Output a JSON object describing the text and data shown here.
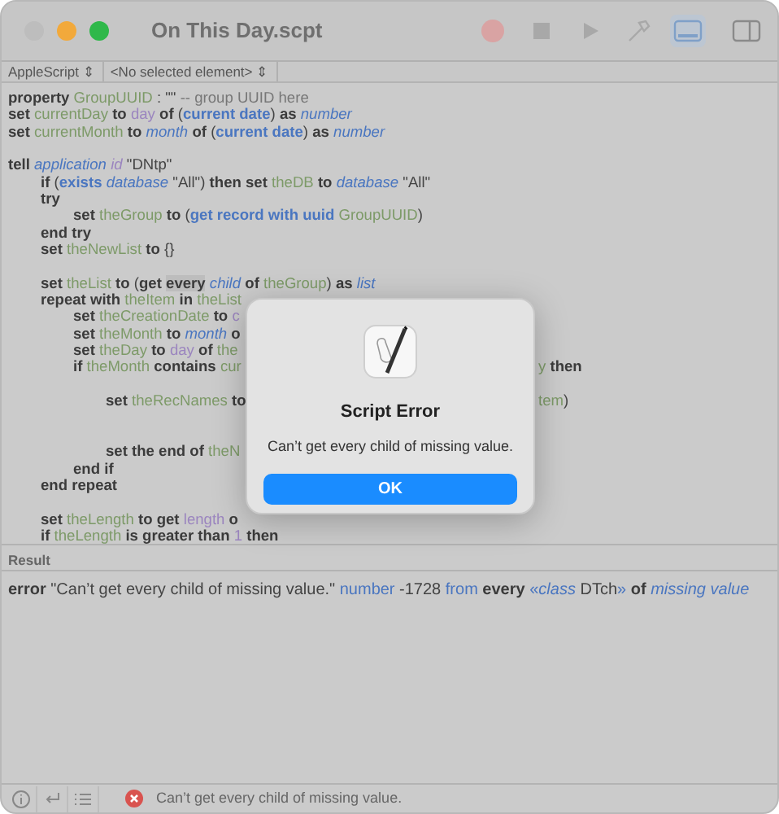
{
  "window": {
    "title": "On This Day.scpt"
  },
  "traffic_lights": [
    {
      "color": "#bdbdbd"
    },
    {
      "color": "#f2a93b"
    },
    {
      "color": "#2fb84a"
    }
  ],
  "toolbar": [
    {
      "kind": "record",
      "selected": false
    },
    {
      "kind": "stop",
      "selected": false
    },
    {
      "kind": "run",
      "selected": false
    },
    {
      "kind": "compile",
      "selected": false
    },
    {
      "kind": "log",
      "selected": true
    },
    {
      "kind": "inspector",
      "selected": false
    }
  ],
  "navigation_bar": [
    {
      "label": "AppleScript",
      "caret": "⇕"
    },
    {
      "label": "<No selected element>",
      "caret": "⇕"
    }
  ],
  "code": [
    {
      "kind": "code",
      "tokens": [
        {
          "kind": "keyword",
          "text": "property "
        },
        {
          "kind": "variable",
          "text": "GroupUUID"
        },
        {
          "kind": "plain",
          "text": " : \"\" "
        },
        {
          "kind": "comment",
          "text": "-- group UUID here"
        }
      ]
    },
    {
      "kind": "code",
      "tokens": [
        {
          "kind": "keyword",
          "text": "set "
        },
        {
          "kind": "variable",
          "text": "currentDay"
        },
        {
          "kind": "keyword",
          "text": " to "
        },
        {
          "kind": "property",
          "text": "day"
        },
        {
          "kind": "keyword",
          "text": " of "
        },
        {
          "kind": "plain",
          "text": "("
        },
        {
          "kind": "command",
          "text": "current date"
        },
        {
          "kind": "plain",
          "text": ") "
        },
        {
          "kind": "keyword",
          "text": "as "
        },
        {
          "kind": "term",
          "text": "number"
        }
      ]
    },
    {
      "kind": "code",
      "tokens": [
        {
          "kind": "keyword",
          "text": "set "
        },
        {
          "kind": "variable",
          "text": "currentMonth"
        },
        {
          "kind": "keyword",
          "text": " to "
        },
        {
          "kind": "term",
          "text": "month"
        },
        {
          "kind": "keyword",
          "text": " of "
        },
        {
          "kind": "plain",
          "text": "("
        },
        {
          "kind": "command",
          "text": "current date"
        },
        {
          "kind": "plain",
          "text": ") "
        },
        {
          "kind": "keyword",
          "text": "as "
        },
        {
          "kind": "term",
          "text": "number"
        }
      ]
    },
    {
      "kind": "blank"
    },
    {
      "kind": "code",
      "tokens": [
        {
          "kind": "keyword",
          "text": "tell "
        },
        {
          "kind": "term",
          "text": "application "
        },
        {
          "kind": "propertyitalic",
          "text": "id"
        },
        {
          "kind": "plain",
          "text": " \"DNtp\""
        }
      ],
      "children": [
        {
          "kind": "code",
          "tokens": [
            {
              "kind": "keyword",
              "text": "if "
            },
            {
              "kind": "plain",
              "text": "("
            },
            {
              "kind": "command",
              "text": "exists "
            },
            {
              "kind": "term",
              "text": "database"
            },
            {
              "kind": "plain",
              "text": " \"All\") "
            },
            {
              "kind": "keyword",
              "text": "then set "
            },
            {
              "kind": "variable",
              "text": "theDB"
            },
            {
              "kind": "keyword",
              "text": " to "
            },
            {
              "kind": "term",
              "text": "database"
            },
            {
              "kind": "plain",
              "text": " \"All\""
            }
          ]
        },
        {
          "kind": "code",
          "tokens": [
            {
              "kind": "keyword",
              "text": "try"
            }
          ],
          "children": [
            {
              "kind": "code",
              "tokens": [
                {
                  "kind": "keyword",
                  "text": "set "
                },
                {
                  "kind": "variable",
                  "text": "theGroup"
                },
                {
                  "kind": "keyword",
                  "text": " to "
                },
                {
                  "kind": "plain",
                  "text": "("
                },
                {
                  "kind": "command",
                  "text": "get record with uuid "
                },
                {
                  "kind": "variable",
                  "text": "GroupUUID"
                },
                {
                  "kind": "plain",
                  "text": ")"
                }
              ]
            }
          ]
        },
        {
          "kind": "code",
          "tokens": [
            {
              "kind": "keyword",
              "text": "end try"
            }
          ]
        },
        {
          "kind": "code",
          "tokens": [
            {
              "kind": "keyword",
              "text": "set "
            },
            {
              "kind": "variable",
              "text": "theNewList"
            },
            {
              "kind": "keyword",
              "text": " to "
            },
            {
              "kind": "plain",
              "text": "{}"
            }
          ]
        },
        {
          "kind": "blank"
        },
        {
          "kind": "code",
          "tokens": [
            {
              "kind": "keyword",
              "text": "set "
            },
            {
              "kind": "variable",
              "text": "theList"
            },
            {
              "kind": "keyword",
              "text": " to "
            },
            {
              "kind": "plain",
              "text": "("
            },
            {
              "kind": "keyword",
              "text": "get "
            },
            {
              "kind": "keyword",
              "text": "every",
              "highlighted": true
            },
            {
              "kind": "term",
              "text": " child"
            },
            {
              "kind": "keyword",
              "text": " of "
            },
            {
              "kind": "variable",
              "text": "theGroup"
            },
            {
              "kind": "plain",
              "text": ") "
            },
            {
              "kind": "keyword",
              "text": "as "
            },
            {
              "kind": "term",
              "text": "list"
            }
          ]
        },
        {
          "kind": "code",
          "tokens": [
            {
              "kind": "keyword",
              "text": "repeat with "
            },
            {
              "kind": "variable",
              "text": "theItem"
            },
            {
              "kind": "keyword",
              "text": " in "
            },
            {
              "kind": "variable",
              "text": "theList"
            }
          ],
          "children": [
            {
              "kind": "code",
              "tokens": [
                {
                  "kind": "keyword",
                  "text": "set "
                },
                {
                  "kind": "variable",
                  "text": "theCreationDate"
                },
                {
                  "kind": "keyword",
                  "text": " to "
                },
                {
                  "kind": "property",
                  "text": "c"
                }
              ]
            },
            {
              "kind": "code",
              "tokens": [
                {
                  "kind": "keyword",
                  "text": "set "
                },
                {
                  "kind": "variable",
                  "text": "theMonth"
                },
                {
                  "kind": "keyword",
                  "text": " to "
                },
                {
                  "kind": "term",
                  "text": "month"
                },
                {
                  "kind": "keyword",
                  "text": " o"
                }
              ]
            },
            {
              "kind": "code",
              "tokens": [
                {
                  "kind": "keyword",
                  "text": "set "
                },
                {
                  "kind": "variable",
                  "text": "theDay"
                },
                {
                  "kind": "keyword",
                  "text": " to "
                },
                {
                  "kind": "property",
                  "text": "day"
                },
                {
                  "kind": "keyword",
                  "text": " of "
                },
                {
                  "kind": "variable",
                  "text": "the"
                }
              ]
            },
            {
              "kind": "code",
              "tokens": [
                {
                  "kind": "keyword",
                  "text": "if "
                },
                {
                  "kind": "variable",
                  "text": "theMonth"
                },
                {
                  "kind": "keyword",
                  "text": " contains "
                },
                {
                  "kind": "variable",
                  "text": "cur"
                }
              ],
              "right_tokens": [
                {
                  "kind": "variable",
                  "text": "y"
                },
                {
                  "kind": "keyword",
                  "text": " then"
                }
              ],
              "children": [
                {
                  "kind": "blank"
                },
                {
                  "kind": "code",
                  "tokens": [
                    {
                      "kind": "keyword",
                      "text": "set "
                    },
                    {
                      "kind": "variable",
                      "text": "theRecNames"
                    },
                    {
                      "kind": "keyword",
                      "text": " to"
                    }
                  ],
                  "right_tokens": [
                    {
                      "kind": "variable",
                      "text": "tem"
                    },
                    {
                      "kind": "plain",
                      "text": ")"
                    }
                  ]
                },
                {
                  "kind": "blank"
                },
                {
                  "kind": "blank"
                },
                {
                  "kind": "code",
                  "tokens": [
                    {
                      "kind": "keyword",
                      "text": "set the end of "
                    },
                    {
                      "kind": "variable",
                      "text": "theN"
                    }
                  ]
                }
              ]
            },
            {
              "kind": "code",
              "tokens": [
                {
                  "kind": "keyword",
                  "text": "end if"
                }
              ]
            }
          ]
        },
        {
          "kind": "code",
          "tokens": [
            {
              "kind": "keyword",
              "text": "end repeat"
            }
          ]
        },
        {
          "kind": "blank"
        },
        {
          "kind": "code",
          "tokens": [
            {
              "kind": "keyword",
              "text": "set "
            },
            {
              "kind": "variable",
              "text": "theLength"
            },
            {
              "kind": "keyword",
              "text": " to get "
            },
            {
              "kind": "property",
              "text": "length"
            },
            {
              "kind": "keyword",
              "text": " o"
            }
          ]
        },
        {
          "kind": "code",
          "tokens": [
            {
              "kind": "keyword",
              "text": "if "
            },
            {
              "kind": "variable",
              "text": "theLength"
            },
            {
              "kind": "keyword",
              "text": " is greater than "
            },
            {
              "kind": "property",
              "text": "1"
            },
            {
              "kind": "keyword",
              "text": " then"
            }
          ]
        }
      ]
    }
  ],
  "dialog": {
    "title": "Script Error",
    "message": "Can’t get every child of missing value.",
    "button": "OK"
  },
  "result": {
    "label": "Result",
    "tokens": [
      {
        "kind": "keyword",
        "text": "error "
      },
      {
        "kind": "plain",
        "text": "\"Can’t get every child of missing value.\" "
      },
      {
        "kind": "termplain",
        "text": "number"
      },
      {
        "kind": "plain",
        "text": " -1728 "
      },
      {
        "kind": "termplain",
        "text": "from"
      },
      {
        "kind": "keyword",
        "text": " every "
      },
      {
        "kind": "termplain",
        "text": "«"
      },
      {
        "kind": "term",
        "text": "class"
      },
      {
        "kind": "plain",
        "text": " DTch"
      },
      {
        "kind": "termplain",
        "text": "»"
      },
      {
        "kind": "keyword",
        "text": " of "
      },
      {
        "kind": "term",
        "text": "missing value"
      }
    ]
  },
  "bottom_bar": {
    "buttons": [
      {
        "kind": "info",
        "selected": false
      },
      {
        "kind": "replies",
        "selected": false
      },
      {
        "kind": "log",
        "selected": false
      }
    ],
    "status": "Can’t get every child of missing value."
  }
}
